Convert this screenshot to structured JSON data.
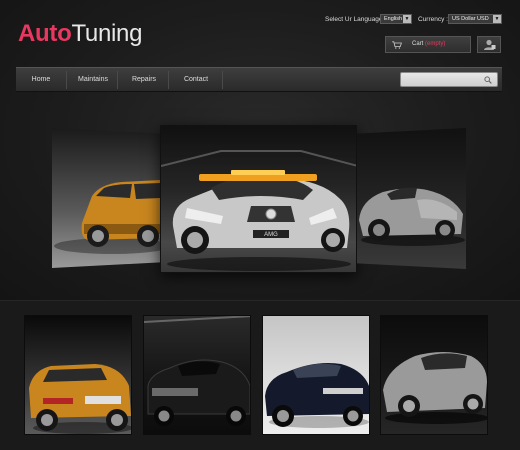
{
  "header": {
    "logo_part1": "Auto",
    "logo_part2": "Tuning",
    "language_label": "Select Ur Language :",
    "language_value": "English",
    "currency_label": "Currency :",
    "currency_value": "US Dollar USD",
    "cart_label": "Cart",
    "cart_status": "(empty)"
  },
  "nav": {
    "items": [
      {
        "label": "Home"
      },
      {
        "label": "Maintains"
      },
      {
        "label": "Repairs"
      },
      {
        "label": "Contact"
      }
    ],
    "search_placeholder": ""
  },
  "slider": {
    "slides": [
      {
        "name": "orange-suv",
        "color": "#c9861f"
      },
      {
        "name": "silver-safety-car",
        "color": "#c8c8c8",
        "accent": "#f0a020"
      },
      {
        "name": "silver-roadster",
        "color": "#9a9a9a"
      }
    ]
  },
  "thumbnails": [
    {
      "name": "orange-suv-rear",
      "color": "#c9861f"
    },
    {
      "name": "black-sedan",
      "color": "#1a1a1a"
    },
    {
      "name": "dark-blue-sedan",
      "color": "#141a2c"
    },
    {
      "name": "silver-coupe",
      "color": "#9a9a9a"
    }
  ],
  "colors": {
    "accent": "#e8385f",
    "background": "#151515",
    "nav": "#333333"
  }
}
